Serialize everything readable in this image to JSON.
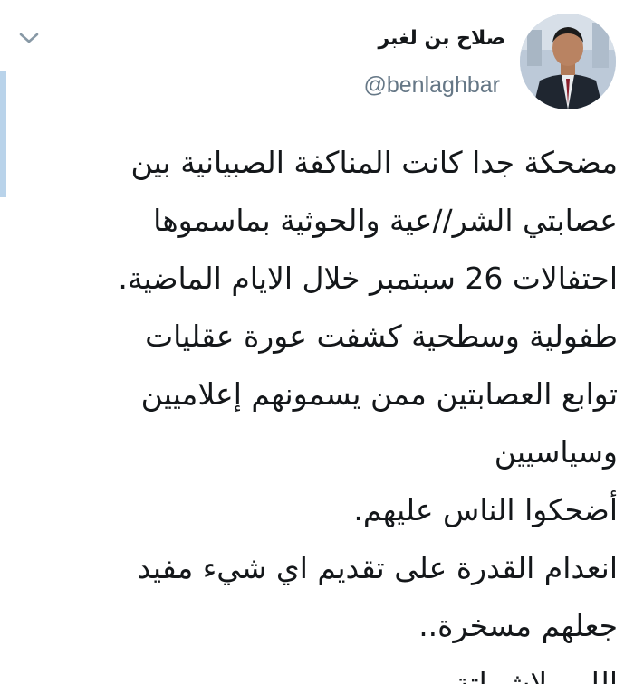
{
  "tweet": {
    "author": {
      "display_name": "صلاح بن لغبر",
      "handle": "@benlaghbar",
      "avatar_icon": "user-avatar"
    },
    "menu_icon": "chevron-down-icon",
    "lines": [
      "مضحكة جدا كانت المناكفة الصبيانية بين",
      "عصابتي الشر//عية والحوثية بماسموها",
      "احتفالات 26 سبتمبر خلال الايام الماضية.",
      "طفولية وسطحية كشفت عورة عقليات",
      "توابع العصابتين ممن يسمونهم إعلاميين",
      "وسياسيين",
      "أضحكوا الناس عليهم.",
      "انعدام القدرة على تقديم اي شيء مفيد",
      "جعلهم مسخرة..",
      "اللهم لاشماتة"
    ]
  },
  "colors": {
    "text": "#14171a",
    "secondary_text": "#657786",
    "accent_bar": "#b9d3ea",
    "background": "#ffffff"
  }
}
